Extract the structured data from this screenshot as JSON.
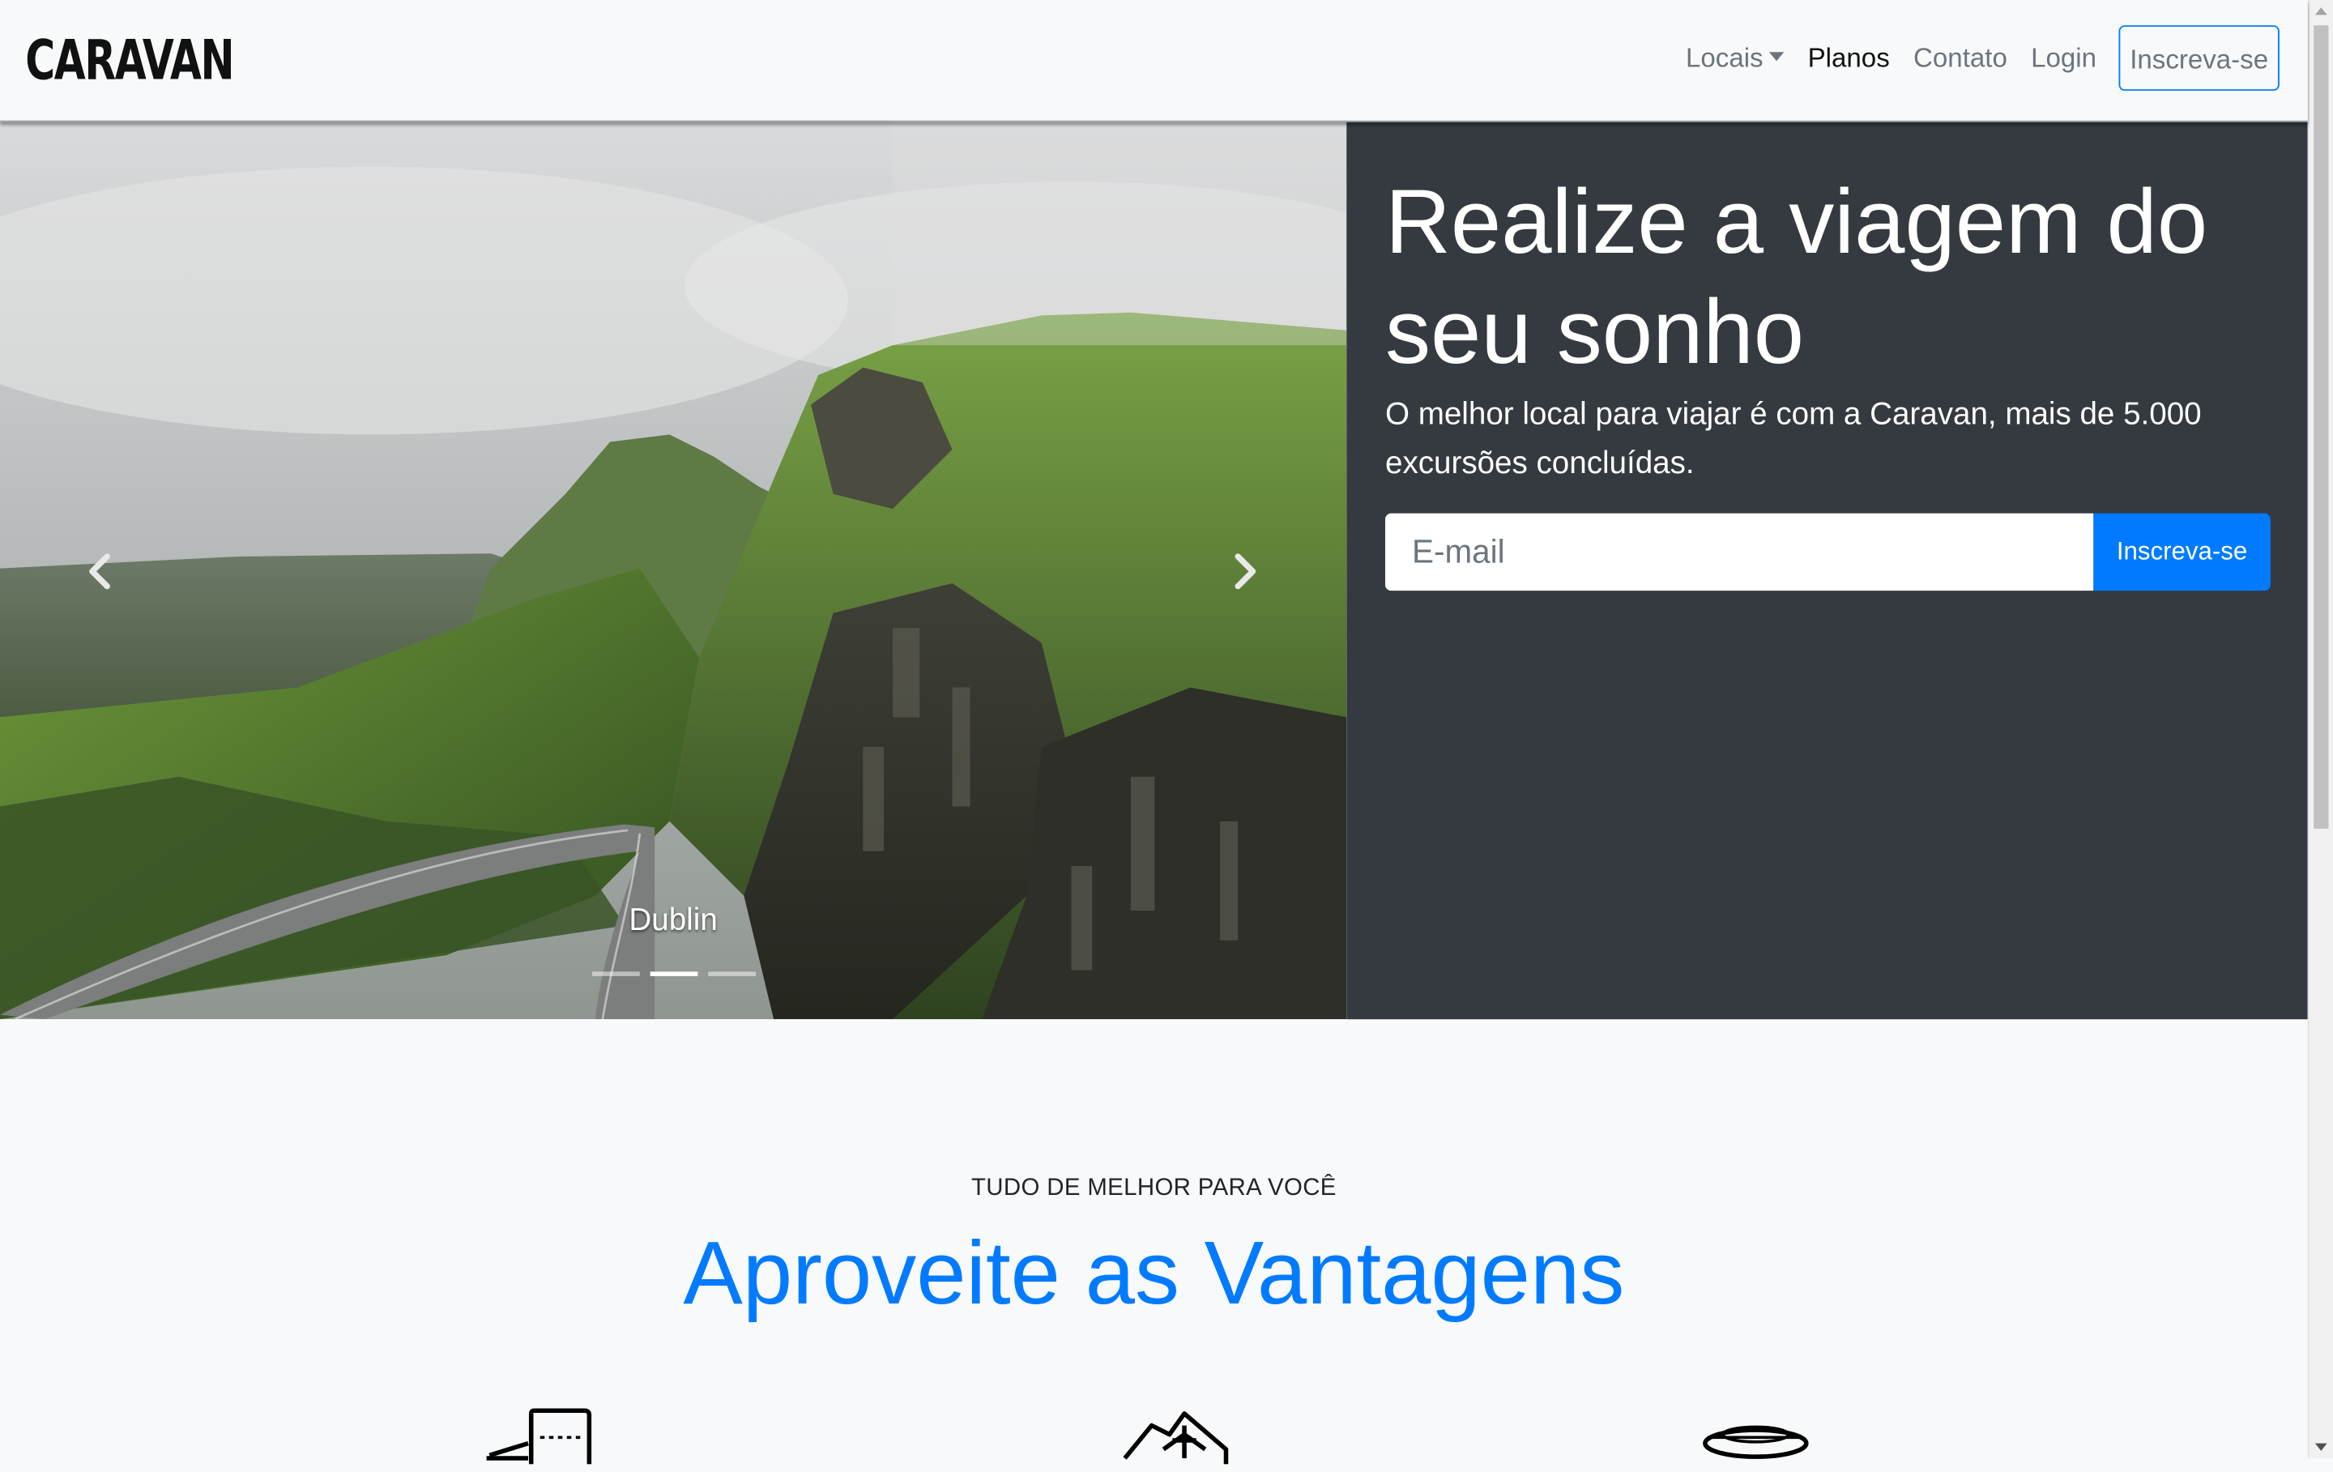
{
  "navbar": {
    "brand": "CARAVAN",
    "links": [
      {
        "label": "Locais",
        "dropdown": true
      },
      {
        "label": "Planos",
        "active": true
      },
      {
        "label": "Contato"
      },
      {
        "label": "Login"
      }
    ],
    "signup_label": "Inscreva-se"
  },
  "hero": {
    "title": "Realize a viagem do seu sonho",
    "subtitle": "O melhor local para viajar é com a Caravan, mais de 5.000 excursões concluídas.",
    "email_placeholder": "E-mail",
    "email_value": "",
    "submit_label": "Inscreva-se",
    "carousel": {
      "caption": "Dublin",
      "slide_count": 3,
      "active_index": 1,
      "prev_icon": "chevron-left-icon",
      "next_icon": "chevron-right-icon"
    }
  },
  "advantages": {
    "eyebrow": "TUDO DE MELHOR PARA VOCÊ",
    "title": "Aproveite as Vantagens",
    "icons": [
      "ticket-icon",
      "airplane-map-icon",
      "hat-icon"
    ]
  },
  "colors": {
    "primary": "#007bff",
    "dark_panel": "#343a40",
    "page_bg": "#f8f9fa",
    "muted": "#6c757d"
  }
}
